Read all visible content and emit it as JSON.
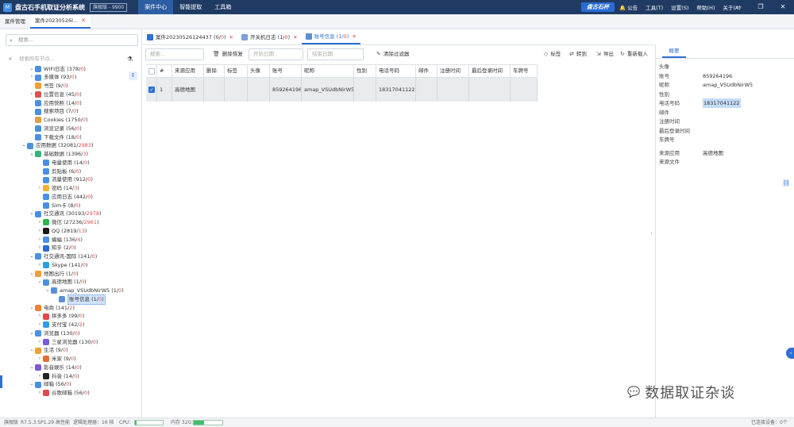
{
  "app": {
    "logo": "M",
    "name": "盘古石手机取证分析系统",
    "edition": "旗舰版 - 9900",
    "menu": [
      "案件中心",
      "智能提取",
      "工具箱"
    ],
    "brand": "盘古石杯",
    "right_menu": [
      "公告",
      "工具(T)",
      "设置(S)",
      "帮助(H)",
      "关于(A)"
    ]
  },
  "case_tabs": [
    {
      "label": "案件管理"
    },
    {
      "label": "案件20230526l..."
    }
  ],
  "sidebar": {
    "search_placeholder": "搜索...",
    "tree_search_placeholder": "搜索所有节点...",
    "tree": [
      {
        "label": "WIFI日志",
        "count": "378",
        "red": "0"
      },
      {
        "label": "多媒体",
        "count": "93",
        "red": "0"
      },
      {
        "label": "书签",
        "count": "9",
        "red": "0"
      },
      {
        "label": "位置信息",
        "count": "45",
        "red": "0"
      },
      {
        "label": "应用快照",
        "count": "14",
        "red": "0"
      },
      {
        "label": "搜索项目",
        "count": "7",
        "red": "0"
      },
      {
        "label": "Cookies",
        "count": "1750",
        "red": "0"
      },
      {
        "label": "浏览记录",
        "count": "56",
        "red": "0"
      },
      {
        "label": "下载文件",
        "count": "18",
        "red": "0"
      },
      {
        "label": "应用数据",
        "count": "32081",
        "red": "2983"
      },
      {
        "label": "基础数据",
        "count": "1396",
        "red": "3"
      },
      {
        "label": "电量使用",
        "count": "14",
        "red": "0"
      },
      {
        "label": "剪贴板",
        "count": "6",
        "red": "0"
      },
      {
        "label": "流量使用",
        "count": "912",
        "red": "0"
      },
      {
        "label": "密码",
        "count": "14",
        "red": "3"
      },
      {
        "label": "应用日志",
        "count": "442",
        "red": "0"
      },
      {
        "label": "Sim卡",
        "count": "8",
        "red": "0"
      },
      {
        "label": "社交通讯",
        "count": "30193",
        "red": "2978"
      },
      {
        "label": "微信",
        "count": "27236",
        "red": "2961"
      },
      {
        "label": "QQ",
        "count": "2819",
        "red": "13"
      },
      {
        "label": "蝙蝠",
        "count": "136",
        "red": "4"
      },
      {
        "label": "知乎",
        "count": "2",
        "red": "0"
      },
      {
        "label": "社交通讯-国际",
        "count": "141",
        "red": "0"
      },
      {
        "label": "Skype",
        "count": "141",
        "red": "0"
      },
      {
        "label": "地图出行",
        "count": "1",
        "red": "0"
      },
      {
        "label": "高德地图",
        "count": "1",
        "red": "0"
      },
      {
        "label": "amap_VSUdbNirW5",
        "count": "1",
        "red": "0"
      },
      {
        "label": "账号信息",
        "count": "1",
        "red": "0"
      },
      {
        "label": "电商",
        "count": "141",
        "red": "2"
      },
      {
        "label": "拼多多",
        "count": "99",
        "red": "0"
      },
      {
        "label": "支付宝",
        "count": "42",
        "red": "2"
      },
      {
        "label": "浏览器",
        "count": "130",
        "red": "0"
      },
      {
        "label": "三星浏览器",
        "count": "130",
        "red": "0"
      },
      {
        "label": "生活",
        "count": "9",
        "red": "0"
      },
      {
        "label": "米家",
        "count": "9",
        "red": "0"
      },
      {
        "label": "影音娱乐",
        "count": "14",
        "red": "0"
      },
      {
        "label": "抖音",
        "count": "14",
        "red": "0"
      },
      {
        "label": "邮箱",
        "count": "56",
        "red": "0"
      },
      {
        "label": "谷歌邮箱",
        "count": "56",
        "red": "0"
      }
    ]
  },
  "main_tabs": [
    {
      "label": "案件20230526124437",
      "count": "0",
      "red": "0"
    },
    {
      "label": "开关机日志",
      "count": "1",
      "red": "0"
    },
    {
      "label": "账号信息",
      "count": "1",
      "red": "0"
    }
  ],
  "toolbar": {
    "search_placeholder": "搜索...",
    "delete_restore": "删除恢复",
    "start_date": "开始日期",
    "end_date": "结束日期",
    "clear_filter": "清除过滤器",
    "tag": "标签",
    "goto": "转到",
    "export": "导出",
    "reload": "重新载入"
  },
  "table": {
    "headers": [
      "#",
      "来源应用",
      "删除",
      "标签",
      "头像",
      "账号",
      "昵称",
      "性别",
      "电话号码",
      "邮件",
      "注册时间",
      "最后登录时间",
      "车牌号"
    ],
    "rows": [
      {
        "index": "1",
        "source": "高德地图",
        "deleted": "",
        "tag": "",
        "avatar": "",
        "account": "859264196",
        "nickname": "amap_VSUdbNirW5",
        "gender": "",
        "phone": "18317041122",
        "email": "",
        "reg_time": "",
        "last_login": "",
        "plate": ""
      }
    ]
  },
  "detail": {
    "tab": "概要",
    "fields": [
      {
        "k": "头像",
        "v": ""
      },
      {
        "k": "账号",
        "v": "859264196"
      },
      {
        "k": "昵称",
        "v": "amap_VSUdbNirW5"
      },
      {
        "k": "性别",
        "v": ""
      },
      {
        "k": "电话号码",
        "v": "18317041122"
      },
      {
        "k": "邮件",
        "v": ""
      },
      {
        "k": "注册时间",
        "v": ""
      },
      {
        "k": "最后登录时间",
        "v": ""
      },
      {
        "k": "车牌号",
        "v": ""
      },
      {
        "k": "来源应用",
        "v": "高德地图"
      },
      {
        "k": "来源文件",
        "v": ""
      }
    ]
  },
  "watermark": "数据取证杂谈",
  "status": {
    "edition": "旗舰版",
    "version": "R7.5.3.SP1.29",
    "mode": "高性能",
    "cpu_cores": "逻辑处理器：16 核",
    "cpu_label": "CPU：",
    "cpu_usage": 0.05,
    "mem_label": "内存 32G：",
    "mem_usage": 0.35,
    "devices": "已连接设备：0个"
  }
}
